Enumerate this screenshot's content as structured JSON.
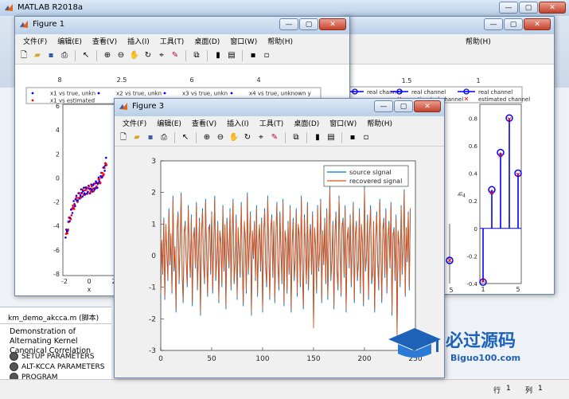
{
  "matlab": {
    "title": "MATLAB R2018a",
    "script_tab": "km_demo_akcca.m  (脚本)",
    "demo_heading": "Demonstration of Alternating Kernel Canonical Correlation",
    "cells": [
      "SETUP PARAMETERS",
      "ALT-KCCA PARAMETERS",
      "PROGRAM"
    ],
    "status": {
      "row_label": "行",
      "row": "1",
      "col_label": "列",
      "col": "1"
    }
  },
  "menu": [
    "文件(F)",
    "编辑(E)",
    "查看(V)",
    "插入(I)",
    "工具(T)",
    "桌面(D)",
    "窗口(W)",
    "帮助(H)"
  ],
  "figure1": {
    "title": "Figure 1",
    "legend_rows": [
      [
        "x1 vs true, unkn",
        "x2 vs true, unkn",
        "x3 vs true, unkn",
        "x4 vs true, unknown y"
      ],
      [
        "x1 vs estimated",
        "",
        "",
        ""
      ]
    ],
    "subplot1_top_tick": "8",
    "xlabel": "x",
    "yticks": [
      "6",
      "4",
      "2",
      "0",
      "-2",
      "-4",
      "-6",
      "-8"
    ],
    "xticks": [
      "-2",
      "0",
      "2"
    ],
    "top_ticks": [
      "8",
      "2.5",
      "6",
      "4"
    ]
  },
  "figure2": {
    "legend_rows": [
      [
        "real channel",
        "real channel",
        "real channel"
      ],
      [
        "",
        "estimated channel",
        "estimated channel"
      ]
    ],
    "top_ticks": [
      "1.5",
      "1"
    ],
    "ylabel": "h",
    "ylabel_sub": "4",
    "yticks": [
      "0.8",
      "0.6",
      "0.4",
      "0.2",
      "0",
      "-0.2",
      "-0.4"
    ],
    "xticks_a": [
      "5"
    ],
    "xticks_b": [
      "1",
      "5"
    ],
    "xlabel_b": "l",
    "stem_values": [
      -0.39,
      0.28,
      0.55,
      0.8,
      0.4
    ],
    "stem_estimated": [
      -0.38,
      0.26,
      0.53,
      0.79,
      0.39
    ],
    "colors": {
      "stem": "#0000ff",
      "estimate": "#ff0000"
    }
  },
  "figure3": {
    "title": "Figure 3",
    "chart_data": {
      "type": "line",
      "title": "",
      "xlabel": "",
      "ylabel": "",
      "xlim": [
        0,
        250
      ],
      "ylim": [
        -3,
        3
      ],
      "xticks": [
        "0",
        "50",
        "100",
        "150",
        "200",
        "250"
      ],
      "yticks": [
        "3",
        "2",
        "1",
        "0",
        "-1",
        "-2",
        "-3"
      ],
      "legend_position": "top-right",
      "series": [
        {
          "name": "source signal",
          "color": "#0072bd"
        },
        {
          "name": "recovered signal",
          "color": "#d95319"
        }
      ],
      "x": [
        0,
        1,
        2,
        3,
        4,
        5,
        6,
        7,
        8,
        9,
        10,
        11,
        12,
        13,
        14,
        15,
        16,
        17,
        18,
        19,
        20,
        21,
        22,
        23,
        24,
        25,
        26,
        27,
        28,
        29,
        30,
        31,
        32,
        33,
        34,
        35,
        36,
        37,
        38,
        39,
        40,
        41,
        42,
        43,
        44,
        45,
        46,
        47,
        48,
        49,
        50,
        51,
        52,
        53,
        54,
        55,
        56,
        57,
        58,
        59,
        60,
        61,
        62,
        63,
        64,
        65,
        66,
        67,
        68,
        69,
        70,
        71,
        72,
        73,
        74,
        75,
        76,
        77,
        78,
        79,
        80,
        81,
        82,
        83,
        84,
        85,
        86,
        87,
        88,
        89,
        90,
        91,
        92,
        93,
        94,
        95,
        96,
        97,
        98,
        99,
        100,
        101,
        102,
        103,
        104,
        105,
        106,
        107,
        108,
        109,
        110,
        111,
        112,
        113,
        114,
        115,
        116,
        117,
        118,
        119,
        120,
        121,
        122,
        123,
        124,
        125,
        126,
        127,
        128,
        129,
        130,
        131,
        132,
        133,
        134,
        135,
        136,
        137,
        138,
        139,
        140,
        141,
        142,
        143,
        144,
        145,
        146,
        147,
        148,
        149,
        150,
        151,
        152,
        153,
        154,
        155,
        156,
        157,
        158,
        159,
        160,
        161,
        162,
        163,
        164,
        165,
        166,
        167,
        168,
        169,
        170,
        171,
        172,
        173,
        174,
        175,
        176,
        177,
        178,
        179,
        180,
        181,
        182,
        183,
        184,
        185,
        186,
        187,
        188,
        189,
        190,
        191,
        192,
        193,
        194,
        195,
        196,
        197,
        198,
        199,
        200,
        201,
        202,
        203,
        204,
        205,
        206,
        207,
        208,
        209,
        210,
        211,
        212,
        213,
        214,
        215,
        216,
        217,
        218,
        219,
        220,
        221,
        222,
        223,
        224,
        225,
        226,
        227,
        228,
        229,
        230,
        231,
        232,
        233,
        234,
        235,
        236,
        237,
        238,
        239,
        240,
        241,
        242,
        243,
        244,
        245,
        246,
        247,
        248,
        249,
        250
      ],
      "source": [
        -1.3,
        0.4,
        -0.6,
        1.2,
        -1.4,
        0.9,
        0.1,
        -0.8,
        1.5,
        -0.3,
        0.6,
        -1.2,
        1.9,
        -0.5,
        0.2,
        -1.8,
        0.8,
        1.4,
        -0.9,
        0.3,
        2.0,
        -0.6,
        -1.5,
        0.7,
        1.1,
        -0.2,
        -1.0,
        1.6,
        0.2,
        -0.7,
        1.3,
        -1.6,
        0.5,
        0.9,
        -0.4,
        1.7,
        -1.1,
        0.0,
        1.2,
        -1.9,
        0.6,
        1.5,
        -0.3,
        -0.9,
        1.8,
        0.1,
        -1.3,
        0.8,
        1.0,
        -0.6,
        1.4,
        -1.2,
        0.3,
        1.9,
        -0.8,
        -0.2,
        1.1,
        -1.5,
        0.7,
        0.4,
        -1.0,
        1.6,
        -0.5,
        0.9,
        -1.7,
        1.2,
        0.2,
        -0.4,
        1.5,
        -1.1,
        0.6,
        1.8,
        -0.9,
        -0.3,
        1.3,
        -1.4,
        0.8,
        0.1,
        -0.7,
        1.7,
        -0.2,
        -1.6,
        1.0,
        0.5,
        -1.2,
        2.0,
        -0.6,
        0.3,
        1.4,
        -1.9,
        0.7,
        -0.1,
        1.1,
        -0.8,
        1.6,
        -1.3,
        0.4,
        0.9,
        -0.5,
        1.2,
        -1.8,
        0.6,
        1.5,
        -0.4,
        -1.0,
        1.9,
        0.2,
        -1.4,
        0.8,
        1.3,
        -0.7,
        1.0,
        -1.5,
        0.5,
        1.7,
        -0.3,
        -1.1,
        1.4,
        0.1,
        -0.9,
        1.8,
        -1.6,
        0.7,
        0.4,
        -1.2,
        1.1,
        -0.6,
        1.6,
        -1.8,
        0.3,
        1.2,
        -0.8,
        -0.2,
        1.5,
        -1.3,
        0.9,
        0.6,
        -1.0,
        1.9,
        -0.4,
        -1.7,
        1.3,
        0.2,
        -0.9,
        1.7,
        -1.1,
        0.5,
        1.0,
        -0.6,
        1.4,
        -2.2,
        0.8,
        0.3,
        -1.2,
        1.6,
        -0.5,
        0.1,
        1.8,
        -1.5,
        0.7,
        -0.3,
        1.2,
        -0.9,
        1.5,
        -1.4,
        0.4,
        2.2,
        -0.8,
        -0.2,
        1.1,
        -1.7,
        0.6,
        1.4,
        -0.5,
        -1.1,
        1.9,
        0.3,
        -1.3,
        0.9,
        1.2,
        -0.7,
        1.6,
        -1.8,
        0.5,
        0.8,
        -0.4,
        1.3,
        -1.0,
        0.2,
        1.7,
        -1.5,
        0.6,
        1.1,
        -0.8,
        -0.3,
        1.5,
        -1.2,
        0.9,
        0.4,
        -1.6,
        2.2,
        -0.5,
        -0.1,
        1.3,
        -1.4,
        0.7,
        1.6,
        -0.9,
        -0.6,
        1.0,
        -1.8,
        0.4,
        1.4,
        -0.3,
        -1.1,
        1.8,
        0.2,
        -1.5,
        0.8,
        1.2,
        -0.7,
        1.5,
        -1.2,
        0.5,
        1.1,
        -0.4,
        1.7,
        -1.9,
        0.6,
        0.9,
        -0.8,
        1.3,
        -2.5,
        0.7,
        0.3,
        -1.0,
        1.6,
        -0.6,
        0.2,
        2.1,
        -1.3,
        0.8,
        -0.2,
        1.4,
        -1.1,
        1.5
      ],
      "recovered": [
        -1.2,
        0.5,
        -0.5,
        1.1,
        -1.3,
        1.0,
        0.2,
        -0.7,
        1.4,
        -0.2,
        0.7,
        -1.1,
        1.8,
        -0.4,
        0.3,
        -1.7,
        0.9,
        1.3,
        -0.8,
        0.4,
        1.9,
        -0.5,
        -1.4,
        0.8,
        1.0,
        -0.1,
        -0.9,
        1.5,
        0.3,
        -0.6,
        1.2,
        -1.5,
        0.6,
        0.8,
        -0.3,
        1.6,
        -1.0,
        0.1,
        1.1,
        -1.8,
        0.7,
        1.4,
        -0.2,
        -0.8,
        1.7,
        0.2,
        -1.2,
        0.9,
        0.9,
        -0.5,
        1.3,
        -1.1,
        0.4,
        1.8,
        -0.7,
        -0.1,
        1.0,
        -1.4,
        0.8,
        0.5,
        -0.9,
        1.5,
        -0.4,
        1.0,
        -1.6,
        1.1,
        0.3,
        -0.3,
        1.4,
        -1.0,
        0.7,
        1.7,
        -0.8,
        -0.2,
        1.2,
        -1.3,
        0.9,
        0.2,
        -0.6,
        1.6,
        -0.1,
        -1.5,
        1.1,
        0.6,
        -1.1,
        1.9,
        -0.5,
        0.4,
        1.3,
        -1.8,
        0.8,
        0.0,
        1.0,
        -0.7,
        1.5,
        -1.2,
        0.5,
        1.0,
        -0.4,
        1.1,
        -1.7,
        0.7,
        1.4,
        -0.3,
        -0.9,
        1.8,
        0.3,
        -1.3,
        0.9,
        1.2,
        -0.6,
        1.1,
        -1.4,
        0.6,
        1.6,
        -0.2,
        -1.0,
        1.3,
        0.2,
        -0.8,
        1.7,
        -1.5,
        0.8,
        0.5,
        -1.1,
        1.0,
        -0.5,
        1.5,
        -1.7,
        0.4,
        1.1,
        -0.7,
        -0.1,
        1.4,
        -1.2,
        1.0,
        0.7,
        -0.9,
        1.8,
        -0.3,
        -1.6,
        1.2,
        0.3,
        -0.8,
        1.6,
        -1.0,
        0.6,
        0.9,
        -0.5,
        1.3,
        -2.3,
        0.9,
        0.4,
        -1.1,
        1.5,
        -0.4,
        0.2,
        1.7,
        -1.4,
        0.8,
        -0.2,
        1.1,
        -0.8,
        1.4,
        -1.3,
        0.5,
        2.1,
        -0.7,
        -0.1,
        1.0,
        -1.6,
        0.7,
        1.3,
        -0.4,
        -1.0,
        1.8,
        0.4,
        -1.2,
        1.0,
        1.1,
        -0.6,
        1.5,
        -1.7,
        0.6,
        0.9,
        -0.3,
        1.2,
        -0.9,
        0.3,
        1.6,
        -1.4,
        0.7,
        1.0,
        -0.7,
        -0.2,
        1.4,
        -1.1,
        1.0,
        0.5,
        -1.5,
        2.1,
        -0.4,
        0.0,
        1.2,
        -1.3,
        0.8,
        1.5,
        -0.8,
        -0.5,
        1.1,
        -1.7,
        0.5,
        1.3,
        -0.2,
        -1.0,
        1.7,
        0.3,
        -1.4,
        0.9,
        1.1,
        -0.6,
        1.4,
        -1.1,
        0.6,
        1.0,
        -0.3,
        1.6,
        -1.8,
        0.7,
        0.8,
        -0.7,
        1.2,
        -2.6,
        0.8,
        0.4,
        -0.9,
        1.5,
        -0.5,
        0.3,
        2.0,
        -1.2,
        0.9,
        -0.1,
        1.3,
        -1.0,
        1.5
      ]
    }
  },
  "watermark": {
    "text": "必过源码",
    "sub": "Biguo100.com"
  }
}
